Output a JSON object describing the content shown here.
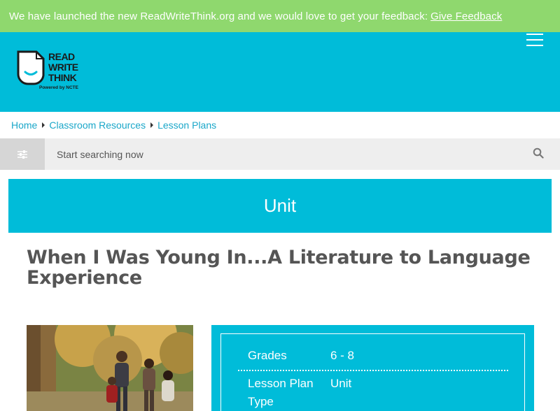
{
  "banner": {
    "text": "We have launched the new ReadWriteThink.org and we would love to get your feedback:",
    "link_label": "Give Feedback"
  },
  "logo": {
    "line1": "READ",
    "line2": "WRITE",
    "line3": "THINK",
    "subtitle": "Powered by NCTE"
  },
  "breadcrumb": {
    "items": [
      "Home",
      "Classroom Resources",
      "Lesson Plans"
    ]
  },
  "search": {
    "placeholder": "Start searching now"
  },
  "resource_type": "Unit",
  "title": "When I Was Young In...A Literature to Language Experience",
  "info": {
    "grades_label": "Grades",
    "grades_value": "6 - 8",
    "type_label": "Lesson Plan Type",
    "type_value": "Unit"
  },
  "colors": {
    "banner": "#8fd86e",
    "brand": "#00bcd9",
    "title": "#555555",
    "breadcrumb_link": "#1aa7c9"
  }
}
